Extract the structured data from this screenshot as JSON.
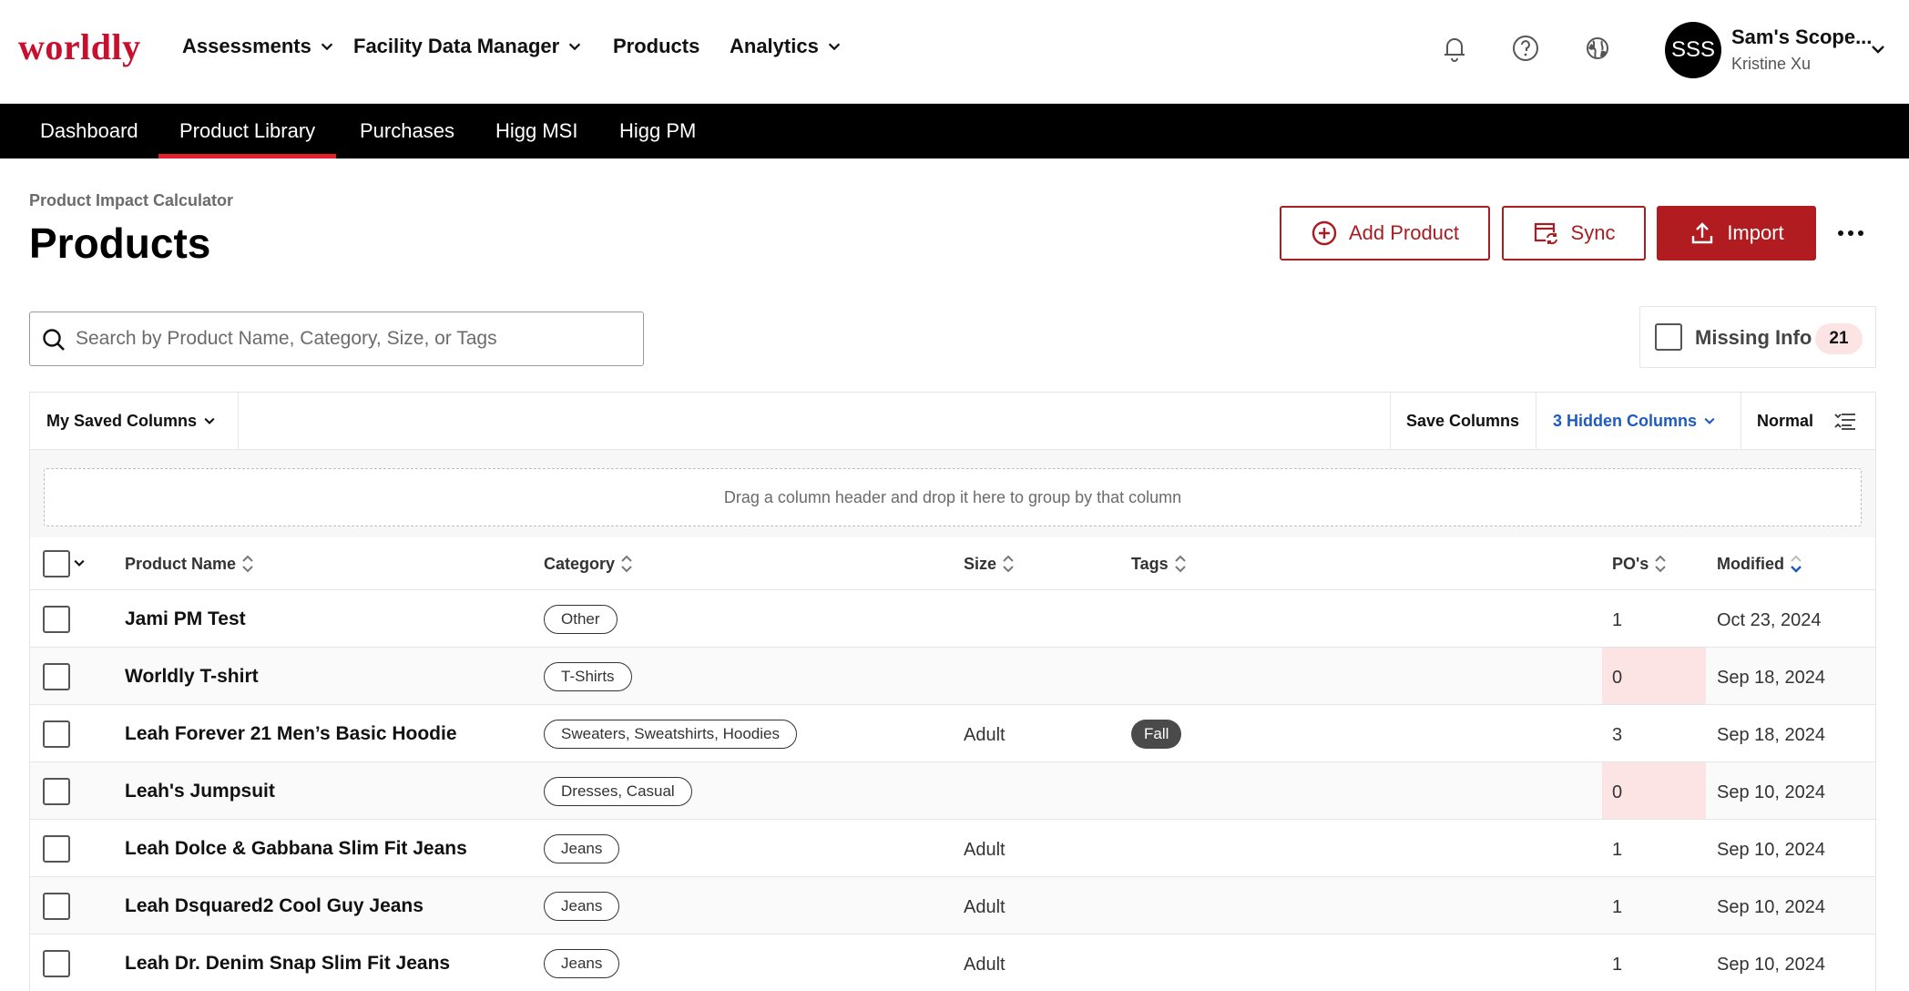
{
  "app": {
    "logo_text": "worldly",
    "brand_color": "#c8102e"
  },
  "top_nav": {
    "items": [
      {
        "label": "Assessments",
        "has_menu": true
      },
      {
        "label": "Facility Data Manager",
        "has_menu": true
      },
      {
        "label": "Products",
        "has_menu": false
      },
      {
        "label": "Analytics",
        "has_menu": true
      }
    ],
    "icons": [
      "bell-icon",
      "help-icon",
      "globe-icon"
    ]
  },
  "user": {
    "initials": "SSS",
    "org": "Sam's Scope...",
    "name": "Kristine Xu"
  },
  "sub_nav": {
    "items": [
      "Dashboard",
      "Product Library",
      "Purchases",
      "Higg MSI",
      "Higg PM"
    ],
    "active": "Product Library",
    "active_color": "#e3202b"
  },
  "page": {
    "breadcrumb": "Product Impact Calculator",
    "title": "Products"
  },
  "actions": {
    "add_product": "Add Product",
    "sync": "Sync",
    "import": "Import",
    "accent_color": "#b01c1f"
  },
  "search": {
    "placeholder": "Search by Product Name, Category, Size, or Tags",
    "value": ""
  },
  "missing_info": {
    "label": "Missing Info",
    "count": "21",
    "checked": false
  },
  "toolbar": {
    "saved_columns": "My Saved Columns",
    "save_columns": "Save Columns",
    "hidden_columns": "3 Hidden Columns",
    "density": "Normal"
  },
  "drop_zone": {
    "text": "Drag a column header and drop it here to group by that column"
  },
  "table": {
    "columns": [
      "Product Name",
      "Category",
      "Size",
      "Tags",
      "PO's",
      "Modified"
    ],
    "sorted_column": "Modified",
    "rows": [
      {
        "name": "Jami PM Test",
        "category": "Other",
        "size": "",
        "tags": "",
        "pos": "1",
        "modified": "Oct 23, 2024"
      },
      {
        "name": "Worldly T-shirt",
        "category": "T-Shirts",
        "size": "",
        "tags": "",
        "pos": "0",
        "modified": "Sep 18, 2024"
      },
      {
        "name": "Leah Forever 21 Men’s Basic Hoodie",
        "category": "Sweaters, Sweatshirts, Hoodies",
        "size": "Adult",
        "tags": "Fall",
        "pos": "3",
        "modified": "Sep 18, 2024"
      },
      {
        "name": "Leah's Jumpsuit",
        "category": "Dresses, Casual",
        "size": "",
        "tags": "",
        "pos": "0",
        "modified": "Sep 10, 2024"
      },
      {
        "name": "Leah Dolce & Gabbana Slim Fit Jeans",
        "category": "Jeans",
        "size": "Adult",
        "tags": "",
        "pos": "1",
        "modified": "Sep 10, 2024"
      },
      {
        "name": "Leah Dsquared2 Cool Guy Jeans",
        "category": "Jeans",
        "size": "Adult",
        "tags": "",
        "pos": "1",
        "modified": "Sep 10, 2024"
      },
      {
        "name": "Leah Dr. Denim Snap Slim Fit Jeans",
        "category": "Jeans",
        "size": "Adult",
        "tags": "",
        "pos": "1",
        "modified": "Sep 10, 2024"
      }
    ],
    "zero_highlight_color": "#fce4e4"
  }
}
